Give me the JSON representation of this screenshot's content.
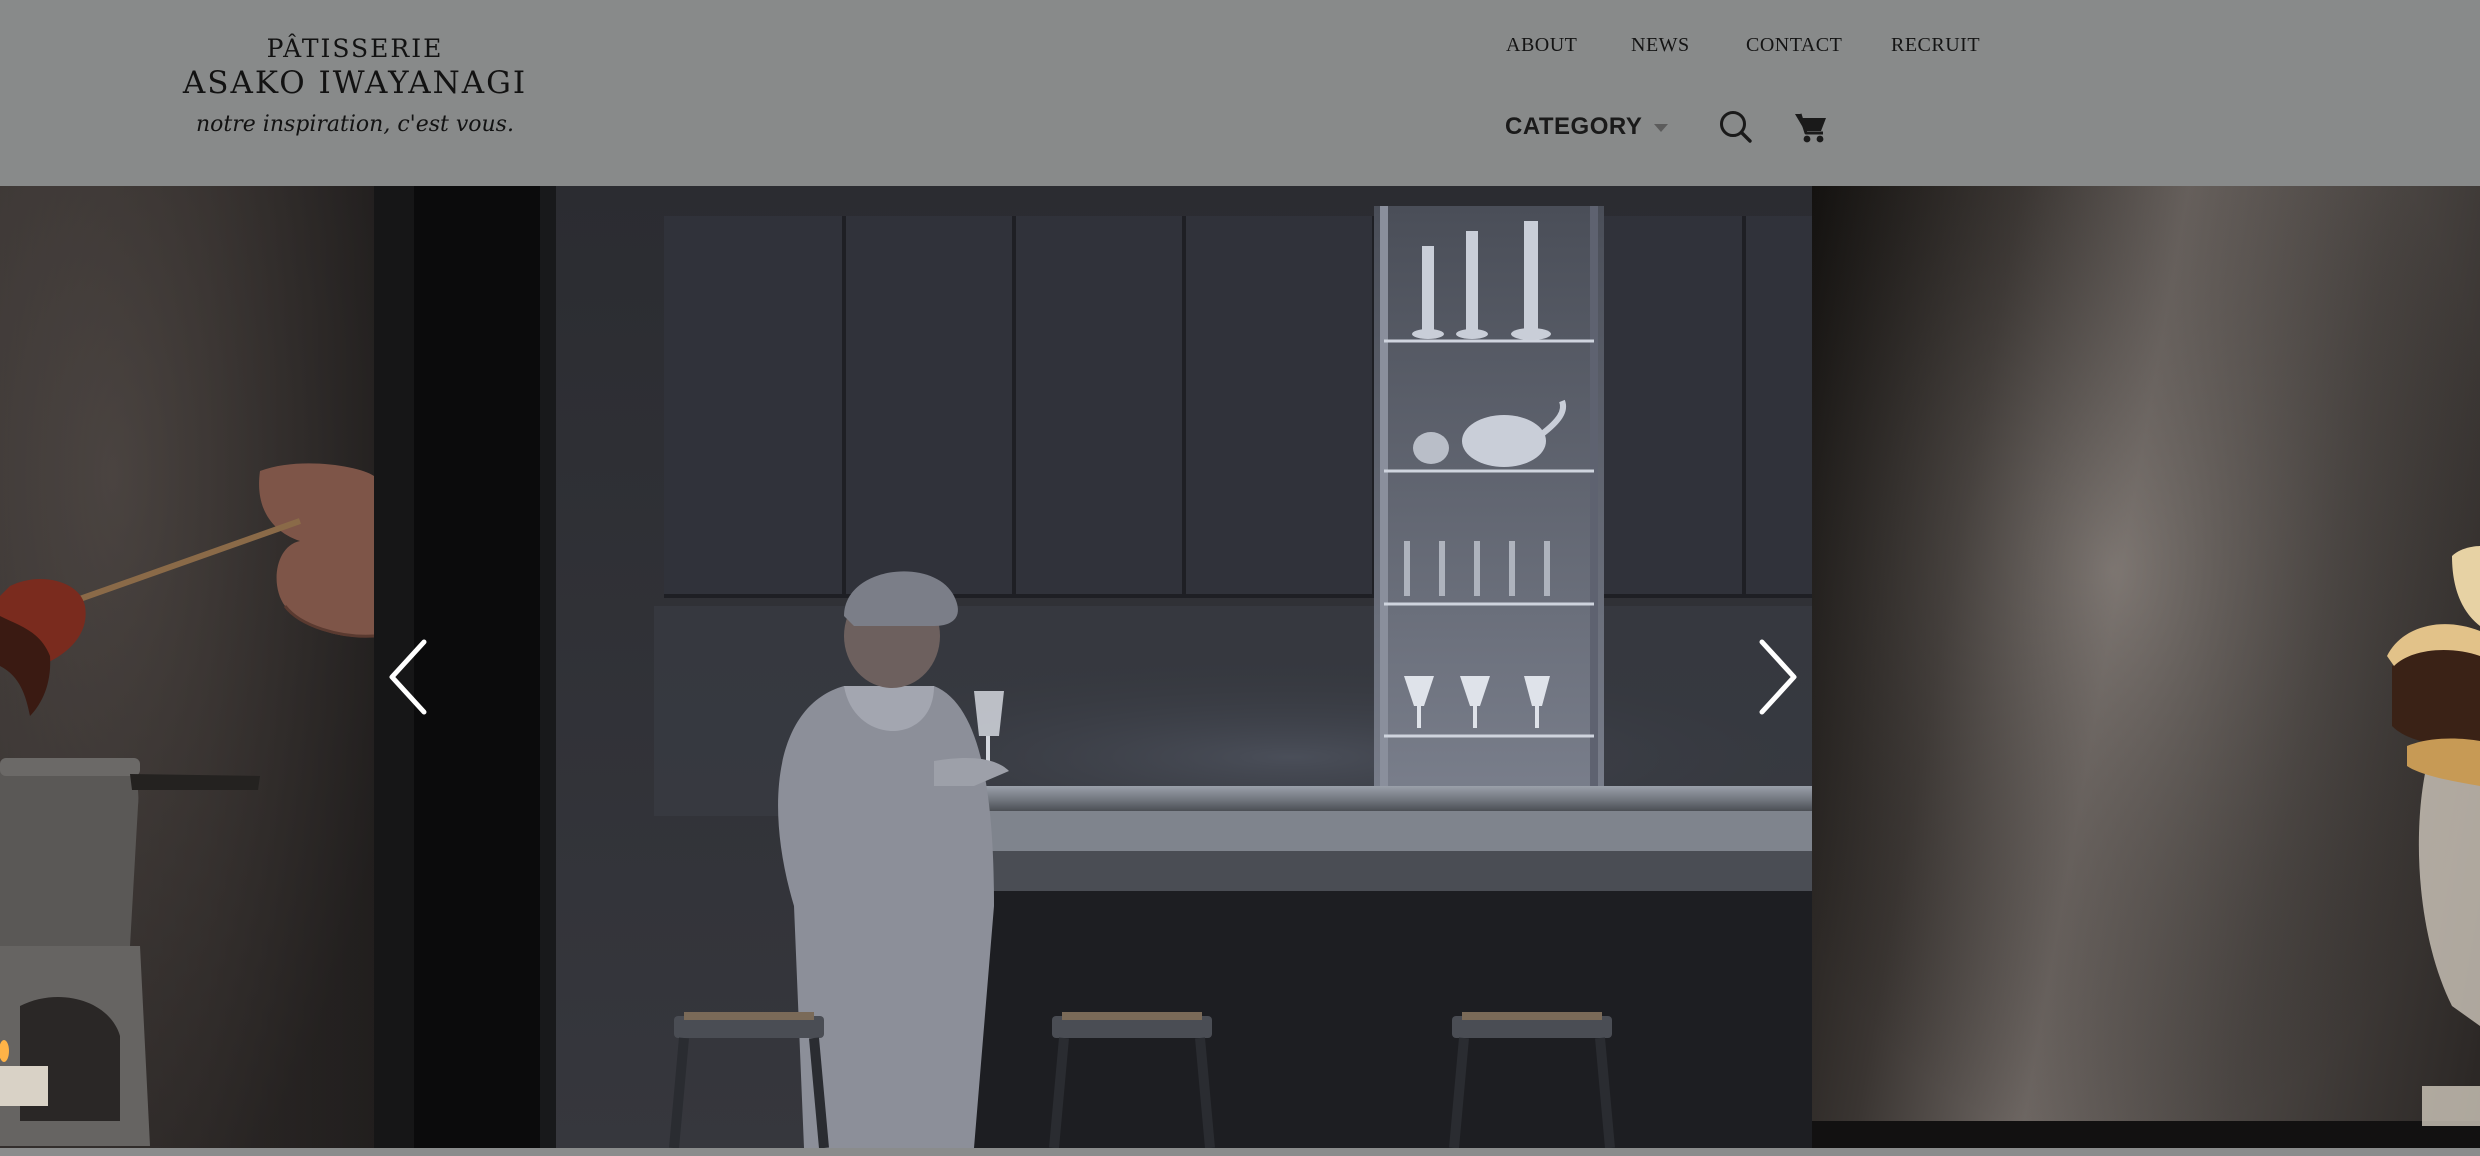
{
  "logo": {
    "line1": "PÂTISSERIE",
    "line2": "ASAKO IWAYANAGI",
    "tagline": "notre inspiration, c'est vous."
  },
  "nav": {
    "about": "ABOUT",
    "news": "NEWS",
    "contact": "CONTACT",
    "recruit": "RECRUIT"
  },
  "category": {
    "label": "CATEGORY"
  },
  "icons": {
    "search": "search-icon",
    "cart": "cart-icon",
    "prev": "chevron-left-icon",
    "next": "chevron-right-icon"
  },
  "colors": {
    "header_bg": "#888a8a",
    "text": "#141414",
    "arrow": "#ffffff"
  }
}
